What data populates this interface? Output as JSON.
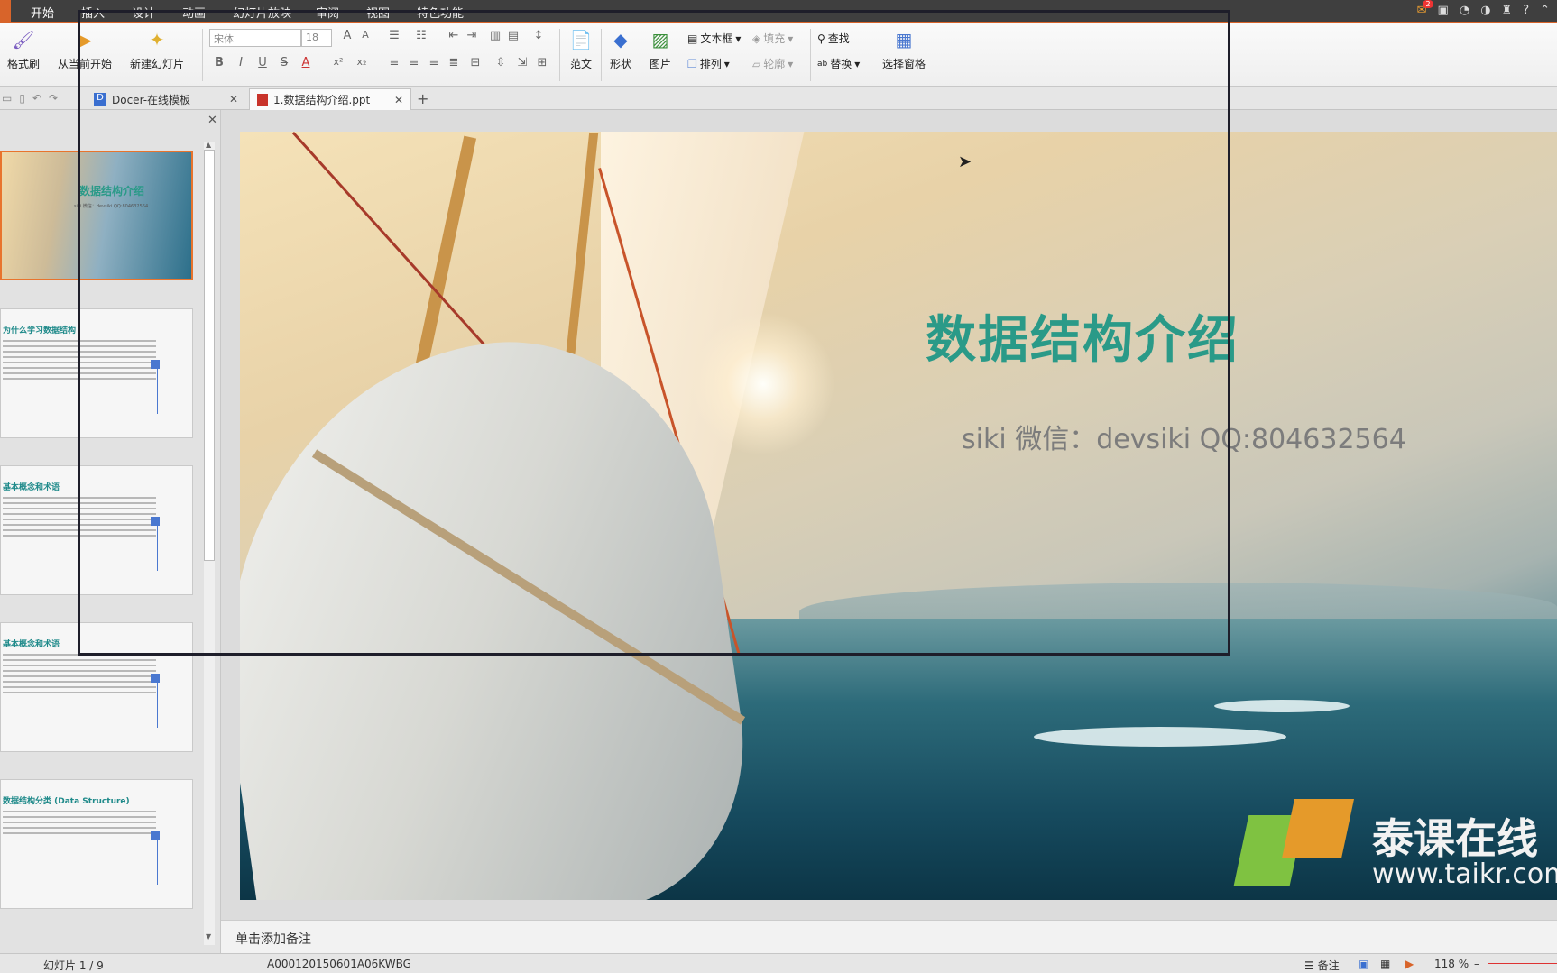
{
  "menubar": {
    "tabs": [
      "开始",
      "插入",
      "设计",
      "动画",
      "幻灯片放映",
      "审阅",
      "视图",
      "特色功能"
    ],
    "active_tab": "开始",
    "mail_badge": "2",
    "help_icon": "?"
  },
  "ribbon": {
    "format_painter": "格式刷",
    "from_current": "从当前开始",
    "new_slide": "新建幻灯片",
    "font_name": "宋体",
    "font_size": "18",
    "template": "范文",
    "shape": "形状",
    "picture": "图片",
    "textbox": "文本框",
    "arrange": "排列",
    "fill": "填充",
    "outline": "轮廓",
    "find": "查找",
    "replace": "替换",
    "select_pane": "选择窗格"
  },
  "doc_tabs": [
    {
      "label": "Docer-在线模板",
      "icon": "docer-icon"
    },
    {
      "label": "1.数据结构介绍.ppt",
      "icon": "ppt-file-icon",
      "active": true
    }
  ],
  "thumbnails": [
    {
      "title": "数据结构介绍",
      "sub": "siki 微信：devsiki QQ:804632564"
    },
    {
      "title": "为什么学习数据结构"
    },
    {
      "title": "基本概念和术语"
    },
    {
      "title": "基本概念和术语"
    },
    {
      "title": "数据结构分类 (Data Structure)"
    }
  ],
  "slide": {
    "title": "数据结构介绍",
    "subtitle": "siki 微信：devsiki QQ:804632564",
    "brand": "泰课在线",
    "url": "www.taikr.com"
  },
  "notes": {
    "placeholder": "单击添加备注"
  },
  "status": {
    "slide_counter": "幻灯片 1 / 9",
    "template_id": "A000120150601A06KWBG",
    "notes_toggle": "备注",
    "zoom": "118 %"
  },
  "colors": {
    "accent": "#d8642a",
    "title": "#2a9a88"
  }
}
